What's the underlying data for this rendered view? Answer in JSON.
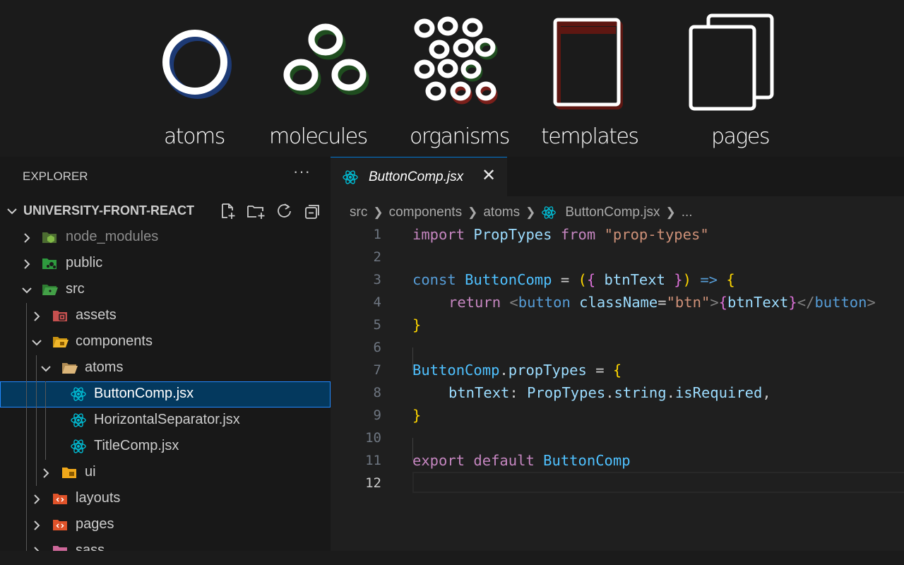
{
  "banner": {
    "stages": [
      {
        "label": "atoms"
      },
      {
        "label": "molecules"
      },
      {
        "label": "organisms"
      },
      {
        "label": "templates"
      },
      {
        "label": "pages"
      }
    ],
    "colors": {
      "atoms": "#1d3a75",
      "molecules": "#1f4d1f",
      "organisms": "#1f4d1f",
      "organisms_accent": "#7a1f1a",
      "templates": "#5e1712"
    }
  },
  "explorer": {
    "header": "EXPLORER",
    "more_label": "···",
    "project_title": "UNIVERSITY-FRONT-REACT",
    "actions": [
      "new-file-icon",
      "new-folder-icon",
      "refresh-icon",
      "collapse-all-icon"
    ],
    "items": [
      {
        "label": "node_modules",
        "icon": "node-folder-icon",
        "expanded": false,
        "depth": 0
      },
      {
        "label": "public",
        "icon": "public-folder-icon",
        "expanded": false,
        "depth": 0
      },
      {
        "label": "src",
        "icon": "src-folder-icon",
        "expanded": true,
        "depth": 0
      },
      {
        "label": "assets",
        "icon": "assets-folder-icon",
        "expanded": false,
        "depth": 1
      },
      {
        "label": "components",
        "icon": "components-folder-icon",
        "expanded": true,
        "depth": 1
      },
      {
        "label": "atoms",
        "icon": "folder-open-icon",
        "expanded": true,
        "depth": 2
      },
      {
        "label": "ButtonComp.jsx",
        "icon": "react-icon",
        "selected": true,
        "depth": 3
      },
      {
        "label": "HorizontalSeparator.jsx",
        "icon": "react-icon",
        "depth": 3
      },
      {
        "label": "TitleComp.jsx",
        "icon": "react-icon",
        "depth": 3
      },
      {
        "label": "ui",
        "icon": "ui-folder-icon",
        "expanded": false,
        "depth": 2
      },
      {
        "label": "layouts",
        "icon": "layouts-folder-icon",
        "expanded": false,
        "depth": 1
      },
      {
        "label": "pages",
        "icon": "pages-folder-icon",
        "expanded": false,
        "depth": 1
      },
      {
        "label": "sass",
        "icon": "sass-folder-icon",
        "expanded": false,
        "depth": 1
      }
    ]
  },
  "editor": {
    "tab": {
      "label": "ButtonComp.jsx",
      "close": "✕"
    },
    "breadcrumb": [
      "src",
      "components",
      "atoms",
      "ButtonComp.jsx",
      "..."
    ],
    "current_line": 12,
    "lines": [
      {
        "n": "1"
      },
      {
        "n": "2"
      },
      {
        "n": "3"
      },
      {
        "n": "4"
      },
      {
        "n": "5"
      },
      {
        "n": "6"
      },
      {
        "n": "7"
      },
      {
        "n": "8"
      },
      {
        "n": "9"
      },
      {
        "n": "10"
      },
      {
        "n": "11"
      },
      {
        "n": "12"
      }
    ],
    "code": {
      "l1": {
        "import": "import",
        "name": "PropTypes",
        "from": "from",
        "module": "\"prop-types\""
      },
      "l3": {
        "const": "const",
        "name": "ButtonComp",
        "eq": "=",
        "open_paren": "(",
        "open_brace": "{",
        "param": "btnText",
        "close_brace": "}",
        "close_paren": ")",
        "arrow": "=>",
        "body_open": "{"
      },
      "l4": {
        "return": "return",
        "tag_open": "<",
        "tag": "button",
        "attr": "className",
        "eq": "=",
        "value": "\"btn\"",
        "tag_close": ">",
        "expr_open": "{",
        "expr": "btnText",
        "expr_close": "}",
        "end_open": "</",
        "end_tag": "button",
        "end_close": ">"
      },
      "l5": {
        "close": "}"
      },
      "l7": {
        "obj": "ButtonComp",
        "dot": ".",
        "prop": "propTypes",
        "eq": "=",
        "open": "{"
      },
      "l8": {
        "key": "btnText",
        "colon": ":",
        "obj": "PropTypes",
        "dot1": ".",
        "prop1": "string",
        "dot2": ".",
        "prop2": "isRequired",
        "comma": ","
      },
      "l9": {
        "close": "}"
      },
      "l11": {
        "export": "export",
        "default": "default",
        "name": "ButtonComp"
      }
    },
    "colors": {
      "keyword": "#569cd6",
      "control": "#c586c0",
      "variable": "#9cdcfe",
      "constant": "#4fc1ff",
      "string": "#ce9178",
      "bracket": "#ffd700",
      "bracket2": "#da70d6",
      "accent": "#0078d4"
    }
  }
}
